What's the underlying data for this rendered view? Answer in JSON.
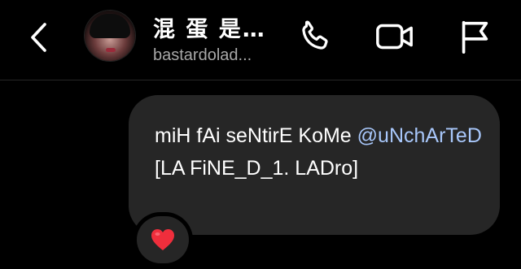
{
  "header": {
    "contact_name": "混 蛋 是…",
    "username": "bastardolad...",
    "icons": {
      "back": "chevron-left-icon",
      "call": "phone-icon",
      "video": "video-camera-icon",
      "report": "flag-icon"
    }
  },
  "messages": [
    {
      "text_before": "miH fAi seNtirE KoMe ",
      "mention": "@uNchArTeD",
      "text_after": " [LA FiNE_D_1. LADro]",
      "reaction_icon": "red-heart-icon",
      "reaction": "❤️"
    }
  ],
  "colors": {
    "background": "#000000",
    "bubble": "#262626",
    "mention": "#a8c7fa",
    "secondary_text": "#a8a8a8",
    "heart": "#ef2e3c"
  }
}
